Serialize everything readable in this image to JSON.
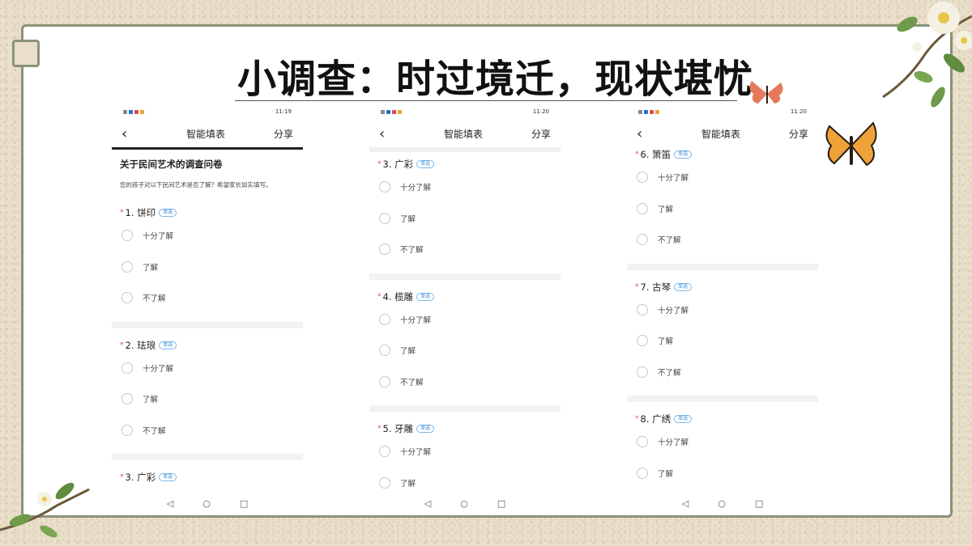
{
  "slide": {
    "title": "小调查：时过境迁，现状堪忧"
  },
  "phones": [
    {
      "status_time": "11:19",
      "nav_title": "智能填表",
      "share": "分享",
      "survey_title": "关于民间艺术的调查问卷",
      "survey_desc": "您的孩子对以下民间艺术是否了解？希望家长如实填写。",
      "questions": [
        {
          "label": "1. 饼印",
          "tag": "单选",
          "options": [
            "十分了解",
            "了解",
            "不了解"
          ]
        },
        {
          "label": "2. 珐琅",
          "tag": "单选",
          "options": [
            "十分了解",
            "了解",
            "不了解"
          ]
        },
        {
          "label": "3. 广彩",
          "tag": "单选",
          "options": []
        }
      ]
    },
    {
      "status_time": "11:20",
      "nav_title": "智能填表",
      "share": "分享",
      "questions": [
        {
          "label": "3. 广彩",
          "tag": "单选",
          "options": [
            "十分了解",
            "了解",
            "不了解"
          ]
        },
        {
          "label": "4. 榄雕",
          "tag": "单选",
          "options": [
            "十分了解",
            "了解",
            "不了解"
          ]
        },
        {
          "label": "5. 牙雕",
          "tag": "单选",
          "options": [
            "十分了解",
            "了解"
          ]
        }
      ]
    },
    {
      "status_time": "11:20",
      "nav_title": "智能填表",
      "share": "分享",
      "questions": [
        {
          "label": "6. 箫笛",
          "tag": "单选",
          "options": [
            "十分了解",
            "了解",
            "不了解"
          ]
        },
        {
          "label": "7. 古琴",
          "tag": "单选",
          "options": [
            "十分了解",
            "了解",
            "不了解"
          ]
        },
        {
          "label": "8. 广绣",
          "tag": "单选",
          "options": [
            "十分了解",
            "了解"
          ]
        }
      ]
    }
  ],
  "icons": {
    "back": "chevron-left-icon",
    "nav_back": "triangle-back-icon",
    "nav_home": "circle-home-icon",
    "nav_recent": "square-recent-icon"
  },
  "colors": {
    "frame": "#8a9378",
    "required_star": "#e14a3a",
    "tag": "#3a8fd9"
  }
}
